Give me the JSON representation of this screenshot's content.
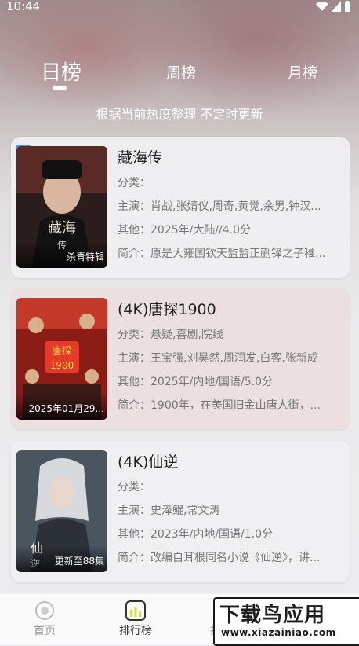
{
  "status": {
    "time": "10:44"
  },
  "tabs": {
    "daily": "日榜",
    "weekly": "周榜",
    "monthly": "月榜"
  },
  "subtitle": "根据当前热度整理 不定时更新",
  "items": [
    {
      "title": "藏海传",
      "poster_note": "杀青特辑",
      "genre_label": "分类：",
      "genre": "",
      "cast_label": "主演：",
      "cast": "肖战,张婧仪,周奇,黄觉,余男,钟汉...",
      "other_label": "其他：",
      "other": "2025年/大陆//4.0分",
      "intro_label": "简介：",
      "intro": "原是大雍国钦天监监正蒯铎之子稚..."
    },
    {
      "title": "(4K)唐探1900",
      "poster_note": "2025年01月29...",
      "genre_label": "分类：",
      "genre": "悬疑,喜剧,院线",
      "cast_label": "主演：",
      "cast": "王宝强,刘昊然,周润发,白客,张新成",
      "other_label": "其他：",
      "other": "2025年/内地/国语/5.0分",
      "intro_label": "简介：",
      "intro": "1900年，在美国旧金山唐人街，..."
    },
    {
      "title": "(4K)仙逆",
      "poster_note": "更新至88集",
      "genre_label": "分类：",
      "genre": "",
      "cast_label": "主演：",
      "cast": "史泽鲲,常文涛",
      "other_label": "其他：",
      "other": "2023年/内地/国语/1.0分",
      "intro_label": "简介：",
      "intro": "改编自耳根同名小说《仙逆》，讲..."
    }
  ],
  "nav": {
    "home": "首页",
    "ranking": "排行榜",
    "third": "排"
  },
  "watermark": {
    "line1": "下载鸟应用",
    "line2": "www.xiazainiao.com"
  },
  "colors": {
    "accent_badge": "#4a8ff0",
    "ranking_icon": "#c6e63a"
  }
}
